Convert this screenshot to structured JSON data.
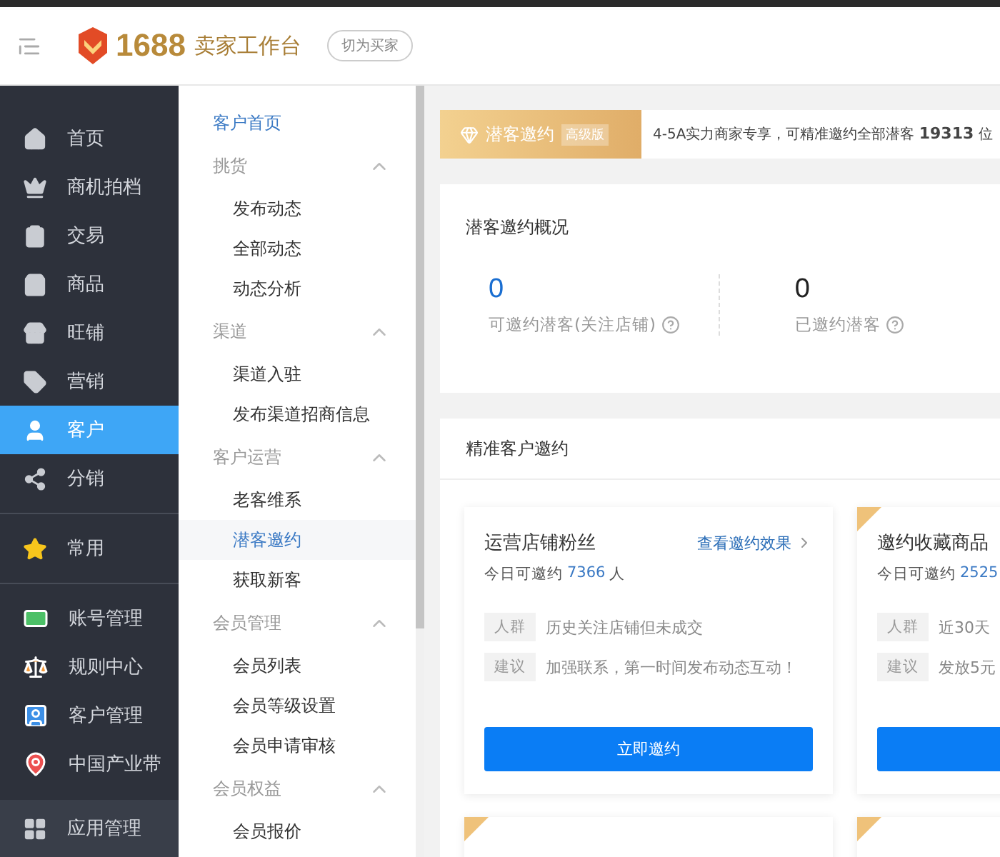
{
  "header": {
    "logo_number": "1688",
    "logo_text": "卖家工作台",
    "switch_button": "切为买家"
  },
  "sidebar": {
    "sections": [
      {
        "items": [
          {
            "label": "首页",
            "selected": false
          },
          {
            "label": "商机拍档",
            "selected": false
          },
          {
            "label": "交易",
            "selected": false
          },
          {
            "label": "商品",
            "selected": false
          },
          {
            "label": "旺铺",
            "selected": false
          },
          {
            "label": "营销",
            "selected": false
          },
          {
            "label": "客户",
            "selected": true
          },
          {
            "label": "分销",
            "selected": false
          }
        ]
      },
      {
        "items": [
          {
            "label": "常用",
            "selected": false
          }
        ]
      },
      {
        "items": [
          {
            "label": "账号管理",
            "selected": false
          },
          {
            "label": "规则中心",
            "selected": false
          },
          {
            "label": "客户管理",
            "selected": false
          },
          {
            "label": "中国产业带",
            "selected": false
          }
        ]
      },
      {
        "items": [
          {
            "label": "应用管理",
            "selected": false
          }
        ]
      }
    ]
  },
  "submenu": [
    {
      "kind": "link",
      "label": "客户首页",
      "selected": false
    },
    {
      "kind": "group",
      "label": "挑货",
      "expanded": true,
      "children": [
        {
          "label": "发布动态",
          "selected": false
        },
        {
          "label": "全部动态",
          "selected": false
        },
        {
          "label": "动态分析",
          "selected": false
        }
      ]
    },
    {
      "kind": "group",
      "label": "渠道",
      "expanded": true,
      "children": [
        {
          "label": "渠道入驻",
          "selected": false
        },
        {
          "label": "发布渠道招商信息",
          "selected": false
        }
      ]
    },
    {
      "kind": "group",
      "label": "客户运营",
      "expanded": true,
      "children": [
        {
          "label": "老客维系",
          "selected": false
        },
        {
          "label": "潜客邀约",
          "selected": true
        },
        {
          "label": "获取新客",
          "selected": false
        }
      ]
    },
    {
      "kind": "group",
      "label": "会员管理",
      "expanded": true,
      "children": [
        {
          "label": "会员列表",
          "selected": false
        },
        {
          "label": "会员等级设置",
          "selected": false
        },
        {
          "label": "会员申请审核",
          "selected": false
        }
      ]
    },
    {
      "kind": "group",
      "label": "会员权益",
      "expanded": true,
      "children": [
        {
          "label": "会员报价",
          "selected": false
        }
      ]
    }
  ],
  "banner": {
    "title": "潜客邀约",
    "badge": "高级版",
    "text": "4-5A实力商家专享，可精准邀约全部潜客 **19313** 位"
  },
  "overview": {
    "title": "潜客邀约概况",
    "stats": [
      {
        "value": "0",
        "label": "可邀约潜客(关注店铺)",
        "highlight": true
      },
      {
        "value": "0",
        "label": "已邀约潜客",
        "highlight": false
      }
    ]
  },
  "invite": {
    "title": "精准客户邀约",
    "cards": [
      {
        "corner_mark": false,
        "title": "运营店铺粉丝",
        "link": "查看邀约效果",
        "count_label": "今日可邀约",
        "count": "7366",
        "count_unit": "人",
        "rows": [
          {
            "tag": "人群",
            "text": "历史关注店铺但未成交"
          },
          {
            "tag": "建议",
            "text": "加强联系，第一时间发布动态互动！"
          }
        ],
        "button": "立即邀约"
      },
      {
        "corner_mark": true,
        "title": "邀约收藏商品",
        "count_label": "今日可邀约",
        "count": "2525",
        "rows": [
          {
            "tag": "人群",
            "text": "近30天"
          },
          {
            "tag": "建议",
            "text": "发放5元"
          }
        ],
        "button_shown": true
      },
      {
        "corner_mark": true
      },
      {
        "corner_mark": true
      }
    ]
  }
}
